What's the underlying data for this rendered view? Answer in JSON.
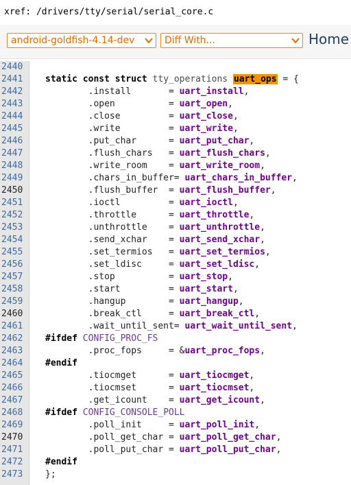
{
  "xref": {
    "text": "xref: /drivers/tty/serial/serial_core.c"
  },
  "nav": {
    "branch": "android-goldfish-4.14-dev",
    "diff": "Diff With...",
    "home": "Home"
  },
  "lines": [
    {
      "num": "2440",
      "parts": []
    },
    {
      "num": "2441",
      "parts": [
        {
          "t": "static const struct",
          "c": "kw"
        },
        {
          "t": " ",
          "c": ""
        },
        {
          "t": "tty_operations",
          "c": "ident"
        },
        {
          "t": " ",
          "c": ""
        },
        {
          "t": "uart_ops",
          "c": "hl"
        },
        {
          "t": " = {",
          "c": ""
        }
      ]
    },
    {
      "num": "2442",
      "parts": [
        {
          "t": "        .install       = ",
          "c": ""
        },
        {
          "t": "uart_install",
          "c": "fn"
        },
        {
          "t": ",",
          "c": ""
        }
      ]
    },
    {
      "num": "2443",
      "parts": [
        {
          "t": "        .open          = ",
          "c": ""
        },
        {
          "t": "uart_open",
          "c": "fn"
        },
        {
          "t": ",",
          "c": ""
        }
      ]
    },
    {
      "num": "2444",
      "parts": [
        {
          "t": "        .close         = ",
          "c": ""
        },
        {
          "t": "uart_close",
          "c": "fn"
        },
        {
          "t": ",",
          "c": ""
        }
      ]
    },
    {
      "num": "2445",
      "parts": [
        {
          "t": "        .write         = ",
          "c": ""
        },
        {
          "t": "uart_write",
          "c": "fn"
        },
        {
          "t": ",",
          "c": ""
        }
      ]
    },
    {
      "num": "2446",
      "parts": [
        {
          "t": "        .put_char      = ",
          "c": ""
        },
        {
          "t": "uart_put_char",
          "c": "fn"
        },
        {
          "t": ",",
          "c": ""
        }
      ]
    },
    {
      "num": "2447",
      "parts": [
        {
          "t": "        .flush_chars   = ",
          "c": ""
        },
        {
          "t": "uart_flush_chars",
          "c": "fn"
        },
        {
          "t": ",",
          "c": ""
        }
      ]
    },
    {
      "num": "2448",
      "parts": [
        {
          "t": "        .write_room    = ",
          "c": ""
        },
        {
          "t": "uart_write_room",
          "c": "fn"
        },
        {
          "t": ",",
          "c": ""
        }
      ]
    },
    {
      "num": "2449",
      "parts": [
        {
          "t": "        .chars_in_buffer= ",
          "c": ""
        },
        {
          "t": "uart_chars_in_buffer",
          "c": "fn"
        },
        {
          "t": ",",
          "c": ""
        }
      ]
    },
    {
      "num": "2450",
      "plain": true,
      "parts": [
        {
          "t": "        .flush_buffer  = ",
          "c": ""
        },
        {
          "t": "uart_flush_buffer",
          "c": "fn"
        },
        {
          "t": ",",
          "c": ""
        }
      ]
    },
    {
      "num": "2451",
      "parts": [
        {
          "t": "        .ioctl         = ",
          "c": ""
        },
        {
          "t": "uart_ioctl",
          "c": "fn"
        },
        {
          "t": ",",
          "c": ""
        }
      ]
    },
    {
      "num": "2452",
      "parts": [
        {
          "t": "        .throttle      = ",
          "c": ""
        },
        {
          "t": "uart_throttle",
          "c": "fn"
        },
        {
          "t": ",",
          "c": ""
        }
      ]
    },
    {
      "num": "2453",
      "parts": [
        {
          "t": "        .unthrottle    = ",
          "c": ""
        },
        {
          "t": "uart_unthrottle",
          "c": "fn"
        },
        {
          "t": ",",
          "c": ""
        }
      ]
    },
    {
      "num": "2454",
      "parts": [
        {
          "t": "        .send_xchar    = ",
          "c": ""
        },
        {
          "t": "uart_send_xchar",
          "c": "fn"
        },
        {
          "t": ",",
          "c": ""
        }
      ]
    },
    {
      "num": "2455",
      "parts": [
        {
          "t": "        .set_termios   = ",
          "c": ""
        },
        {
          "t": "uart_set_termios",
          "c": "fn"
        },
        {
          "t": ",",
          "c": ""
        }
      ]
    },
    {
      "num": "2456",
      "parts": [
        {
          "t": "        .set_ldisc     = ",
          "c": ""
        },
        {
          "t": "uart_set_ldisc",
          "c": "fn"
        },
        {
          "t": ",",
          "c": ""
        }
      ]
    },
    {
      "num": "2457",
      "parts": [
        {
          "t": "        .stop          = ",
          "c": ""
        },
        {
          "t": "uart_stop",
          "c": "fn"
        },
        {
          "t": ",",
          "c": ""
        }
      ]
    },
    {
      "num": "2458",
      "parts": [
        {
          "t": "        .start         = ",
          "c": ""
        },
        {
          "t": "uart_start",
          "c": "fn"
        },
        {
          "t": ",",
          "c": ""
        }
      ]
    },
    {
      "num": "2459",
      "parts": [
        {
          "t": "        .hangup        = ",
          "c": ""
        },
        {
          "t": "uart_hangup",
          "c": "fn"
        },
        {
          "t": ",",
          "c": ""
        }
      ]
    },
    {
      "num": "2460",
      "plain": true,
      "parts": [
        {
          "t": "        .break_ctl     = ",
          "c": ""
        },
        {
          "t": "uart_break_ctl",
          "c": "fn"
        },
        {
          "t": ",",
          "c": ""
        }
      ]
    },
    {
      "num": "2461",
      "parts": [
        {
          "t": "        .wait_until_sent= ",
          "c": ""
        },
        {
          "t": "uart_wait_until_sent",
          "c": "fn"
        },
        {
          "t": ",",
          "c": ""
        }
      ]
    },
    {
      "num": "2462",
      "parts": [
        {
          "t": "#ifdef",
          "c": "pre"
        },
        {
          "t": " ",
          "c": ""
        },
        {
          "t": "CONFIG_PROC_FS",
          "c": "macro"
        }
      ]
    },
    {
      "num": "2463",
      "parts": [
        {
          "t": "        .proc_fops     = &",
          "c": ""
        },
        {
          "t": "uart_proc_fops",
          "c": "fn"
        },
        {
          "t": ",",
          "c": ""
        }
      ]
    },
    {
      "num": "2464",
      "parts": [
        {
          "t": "#endif",
          "c": "pre"
        }
      ]
    },
    {
      "num": "2465",
      "parts": [
        {
          "t": "        .tiocmget      = ",
          "c": ""
        },
        {
          "t": "uart_tiocmget",
          "c": "fn"
        },
        {
          "t": ",",
          "c": ""
        }
      ]
    },
    {
      "num": "2466",
      "parts": [
        {
          "t": "        .tiocmset      = ",
          "c": ""
        },
        {
          "t": "uart_tiocmset",
          "c": "fn"
        },
        {
          "t": ",",
          "c": ""
        }
      ]
    },
    {
      "num": "2467",
      "parts": [
        {
          "t": "        .get_icount    = ",
          "c": ""
        },
        {
          "t": "uart_get_icount",
          "c": "fn"
        },
        {
          "t": ",",
          "c": ""
        }
      ]
    },
    {
      "num": "2468",
      "parts": [
        {
          "t": "#ifdef",
          "c": "pre"
        },
        {
          "t": " ",
          "c": ""
        },
        {
          "t": "CONFIG_CONSOLE_POLL",
          "c": "macro"
        }
      ]
    },
    {
      "num": "2469",
      "parts": [
        {
          "t": "        .poll_init     = ",
          "c": ""
        },
        {
          "t": "uart_poll_init",
          "c": "fn"
        },
        {
          "t": ",",
          "c": ""
        }
      ]
    },
    {
      "num": "2470",
      "plain": true,
      "parts": [
        {
          "t": "        .poll_get_char = ",
          "c": ""
        },
        {
          "t": "uart_poll_get_char",
          "c": "fn"
        },
        {
          "t": ",",
          "c": ""
        }
      ]
    },
    {
      "num": "2471",
      "parts": [
        {
          "t": "        .poll_put_char = ",
          "c": ""
        },
        {
          "t": "uart_poll_put_char",
          "c": "fn"
        },
        {
          "t": ",",
          "c": ""
        }
      ]
    },
    {
      "num": "2472",
      "parts": [
        {
          "t": "#endif",
          "c": "pre"
        }
      ]
    },
    {
      "num": "2473",
      "parts": [
        {
          "t": "};",
          "c": ""
        }
      ]
    }
  ]
}
